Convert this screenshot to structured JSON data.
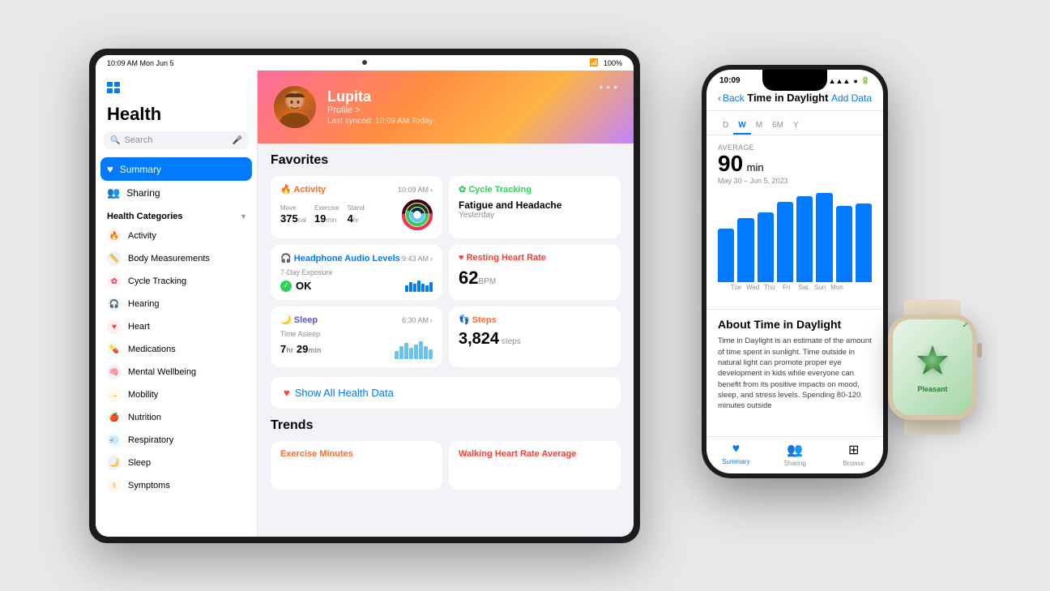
{
  "scene": {
    "bg": "#e8e8ea"
  },
  "ipad": {
    "statusbar": {
      "time": "10:09 AM  Mon Jun 5",
      "battery": "100%",
      "wifi": "●"
    },
    "sidebar": {
      "title": "Health",
      "search_placeholder": "Search",
      "nav": [
        {
          "id": "summary",
          "label": "Summary",
          "icon": "♥",
          "active": true
        },
        {
          "id": "sharing",
          "label": "Sharing",
          "icon": "👥",
          "active": false
        }
      ],
      "categories_label": "Health Categories",
      "categories_chevron": "▾",
      "categories": [
        {
          "id": "activity",
          "label": "Activity",
          "icon": "🔥",
          "color": "#ff6b2b"
        },
        {
          "id": "body",
          "label": "Body Measurements",
          "icon": "📏",
          "color": "#5856d6"
        },
        {
          "id": "cycle",
          "label": "Cycle Tracking",
          "icon": "✿",
          "color": "#ff2d55"
        },
        {
          "id": "hearing",
          "label": "Hearing",
          "icon": "🎧",
          "color": "#5ac8fa"
        },
        {
          "id": "heart",
          "label": "Heart",
          "icon": "♥",
          "color": "#ff3b30"
        },
        {
          "id": "meds",
          "label": "Medications",
          "icon": "💊",
          "color": "#30d158"
        },
        {
          "id": "mental",
          "label": "Mental Wellbeing",
          "icon": "🧠",
          "color": "#5856d6"
        },
        {
          "id": "mobility",
          "label": "Mobility",
          "icon": "→",
          "color": "#ff9500"
        },
        {
          "id": "nutrition",
          "label": "Nutrition",
          "icon": "🍎",
          "color": "#30d158"
        },
        {
          "id": "respiratory",
          "label": "Respiratory",
          "icon": "💨",
          "color": "#5ac8fa"
        },
        {
          "id": "sleep",
          "label": "Sleep",
          "icon": "🌙",
          "color": "#5856d6"
        },
        {
          "id": "symptoms",
          "label": "Symptoms",
          "icon": "⚕",
          "color": "#ff9500"
        }
      ]
    },
    "main": {
      "profile": {
        "name": "Lupita",
        "link": "Profile >",
        "sync": "Last synced: 10:09 AM Today"
      },
      "favorites_label": "Favorites",
      "cards": {
        "activity": {
          "title": "Activity",
          "time": "10:09 AM",
          "move_label": "Move",
          "move_value": "375",
          "move_unit": "cal",
          "exercise_label": "Exercise",
          "exercise_value": "19",
          "exercise_unit": "min",
          "stand_label": "Stand",
          "stand_value": "4",
          "stand_unit": "hr"
        },
        "cycle": {
          "title": "Cycle Tracking",
          "subtitle": "Fatigue and Headache",
          "when": "Yesterday"
        },
        "headphone": {
          "title": "Headphone Audio Levels",
          "time": "9:43 AM",
          "exposure_label": "7-Day Exposure",
          "status": "OK"
        },
        "heart": {
          "title": "Resting Heart Rate",
          "value": "62",
          "unit": "BPM"
        },
        "sleep": {
          "title": "Sleep",
          "time": "6:30 AM",
          "label": "Time Asleep",
          "hours": "7",
          "minutes": "29"
        },
        "steps": {
          "title": "Steps",
          "value": "3,824",
          "unit": "steps"
        }
      },
      "show_all": "Show All Health Data",
      "trends_label": "Trends",
      "trends": [
        {
          "title": "Exercise Minutes",
          "color": "orange"
        },
        {
          "title": "Walking Heart Rate Average",
          "color": "red"
        }
      ]
    }
  },
  "iphone": {
    "statusbar": {
      "time": "10:09",
      "signal": "●●●",
      "wifi": "▲",
      "battery": "⬜"
    },
    "header": {
      "back": "Back",
      "title": "Time in Daylight",
      "add": "Add Data"
    },
    "tabs": [
      "D",
      "W",
      "M",
      "6M",
      "Y"
    ],
    "active_tab": "6M",
    "avg_label": "AVERAGE",
    "avg_value": "90",
    "avg_unit": "min",
    "date_range": "May 30 – Jun 5, 2023",
    "chart_bars": [
      55,
      70,
      75,
      90,
      95,
      100,
      85,
      88
    ],
    "chart_labels": [
      "Tue",
      "Wed",
      "Thu",
      "Fri",
      "Sat",
      "Sun",
      "Mon"
    ],
    "about_title": "About Time in Daylight",
    "about_text": "Time in Daylight is an estimate of the amount of time spent in sunlight. Time outside in natural light can promote proper eye development in kids while everyone can benefit from its positive impacts on mood, sleep, and stress levels. Spending 80-120 minutes outside",
    "tabbar": [
      {
        "id": "summary",
        "icon": "♥",
        "label": "Summary",
        "active": true
      },
      {
        "id": "sharing",
        "icon": "👥",
        "label": "Sharing",
        "active": false
      },
      {
        "id": "browse",
        "icon": "⊞",
        "label": "Browse",
        "active": false
      }
    ]
  },
  "watch": {
    "mood": "Pleasant",
    "check": "✓"
  }
}
